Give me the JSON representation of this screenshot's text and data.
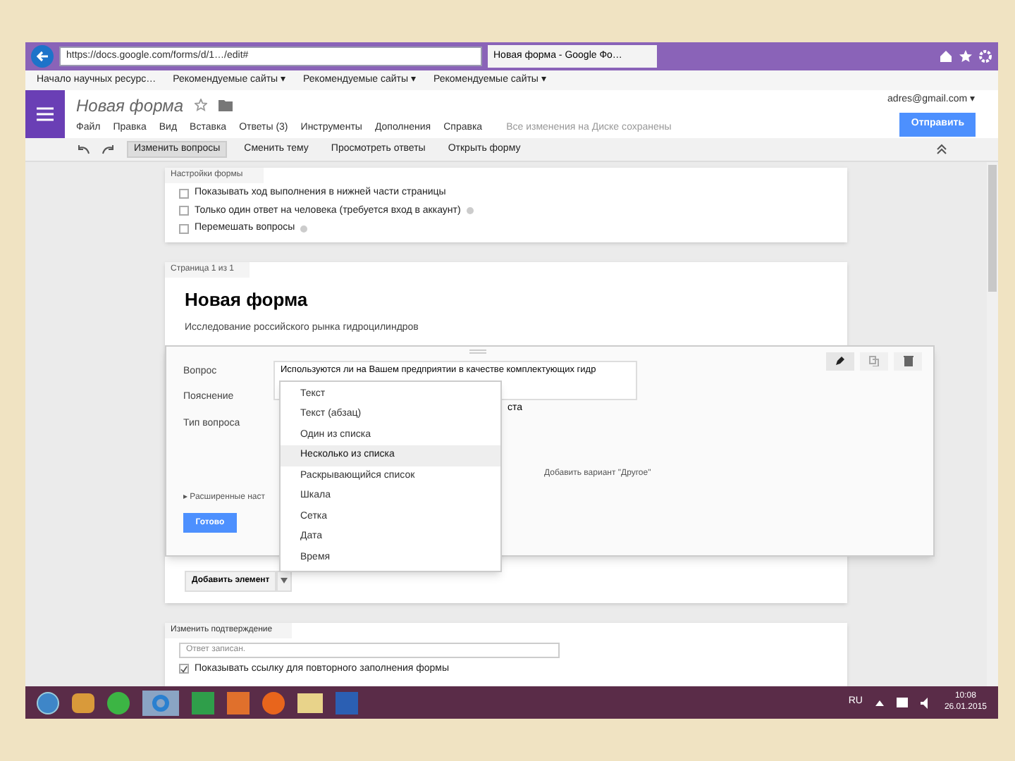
{
  "browser": {
    "url": "https://docs.google.com/forms/d/1…/edit#",
    "tab_title": "Новая форма - Google Фо…",
    "bookmarks": [
      "Начало научных ресурс…",
      "Рекомендуемые сайты ▾",
      "Рекомендуемые сайты ▾",
      "Рекомендуемые сайты ▾"
    ]
  },
  "app": {
    "title": "Новая форма",
    "account": "adres@gmail.com ▾",
    "send_button": "Отправить",
    "save_status": "Все изменения на Диске сохранены",
    "menu": [
      "Файл",
      "Правка",
      "Вид",
      "Вставка",
      "Ответы (3)",
      "Инструменты",
      "Дополнения",
      "Справка"
    ],
    "toolbar": [
      {
        "label": "Изменить вопросы",
        "selected": true
      },
      {
        "label": "Сменить тему",
        "selected": false
      },
      {
        "label": "Просмотреть ответы",
        "selected": false
      },
      {
        "label": "Открыть форму",
        "selected": false
      }
    ]
  },
  "settings": {
    "tab": "Настройки формы",
    "options": [
      {
        "label": "Показывать ход выполнения в нижней части страницы",
        "checked": false,
        "help": false
      },
      {
        "label": "Только один ответ на человека (требуется вход в аккаунт)",
        "checked": false,
        "help": true
      },
      {
        "label": "Перемешать вопросы",
        "checked": false,
        "help": true
      }
    ]
  },
  "page": {
    "tab": "Страница 1 из 1",
    "title": "Новая форма",
    "description": "Исследование российского рынка гидроцилиндров",
    "question": {
      "question_label": "Вопрос",
      "question_value": "Используются ли на Вашем предприятии в качестве комплектующих гидр",
      "hint_label": "Пояснение",
      "type_label": "Тип вопроса",
      "type_tail": "ста",
      "add_other": "Добавить вариант \"Другое\"",
      "advanced": "▸ Расширенные наст",
      "done_button": "Готово"
    },
    "type_menu": [
      {
        "label": "Текст",
        "selected": false
      },
      {
        "label": "Текст (абзац)",
        "selected": false
      },
      {
        "label": "Один из списка",
        "selected": false
      },
      {
        "label": "Несколько из списка",
        "selected": true
      },
      {
        "label": "Раскрывающийся список",
        "selected": false
      },
      {
        "label": "Шкала",
        "selected": false
      },
      {
        "label": "Сетка",
        "selected": false
      },
      {
        "label": "Дата",
        "selected": false
      },
      {
        "label": "Время",
        "selected": false
      }
    ],
    "add_item_button": "Добавить элемент"
  },
  "confirmation": {
    "tab": "Изменить подтверждение",
    "placeholder": "Ответ записан.",
    "option": {
      "label": "Показывать ссылку для повторного заполнения формы",
      "checked": true
    }
  },
  "taskbar": {
    "language": "RU",
    "time": "10:08",
    "date": "26.01.2015"
  }
}
